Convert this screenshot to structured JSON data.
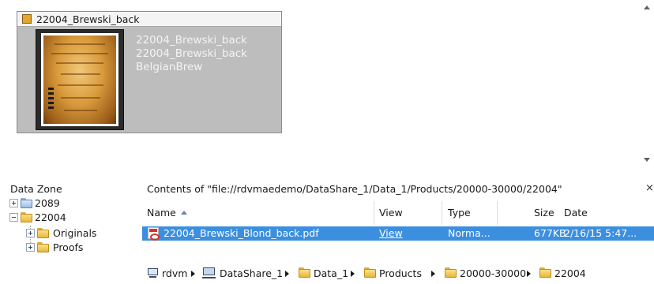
{
  "preview": {
    "card_title": "22004_Brewski_back",
    "meta": [
      "22004_Brewski_back",
      "22004_Brewski_back",
      "BelgianBrew"
    ]
  },
  "data_zone": {
    "title": "Data Zone",
    "nodes": [
      {
        "label": "2089",
        "expanded": false,
        "icon": "folder-blue-icon"
      },
      {
        "label": "22004",
        "expanded": true,
        "icon": "folder-icon"
      },
      {
        "label": "Originals",
        "expanded": false,
        "icon": "folder-icon"
      },
      {
        "label": "Proofs",
        "expanded": false,
        "icon": "folder-icon"
      }
    ]
  },
  "contents": {
    "title": "Contents of \"file://rdvmaedemo/DataShare_1/Data_1/Products/20000-30000/22004\"",
    "close_label": "×",
    "columns": {
      "name": "Name",
      "view": "View",
      "type": "Type",
      "size": "Size",
      "date": "Date"
    },
    "rows": [
      {
        "name": "22004_Brewski_Blond_back.pdf",
        "view": "View",
        "type": "Norma...",
        "size": "677KB",
        "date": "2/16/15 5:47..."
      }
    ],
    "selection_color": "#3c8fdf"
  },
  "path": {
    "crumbs": [
      "rdvm",
      "DataShare_1",
      "Data_1",
      "Products",
      "20000-30000",
      "22004"
    ]
  }
}
